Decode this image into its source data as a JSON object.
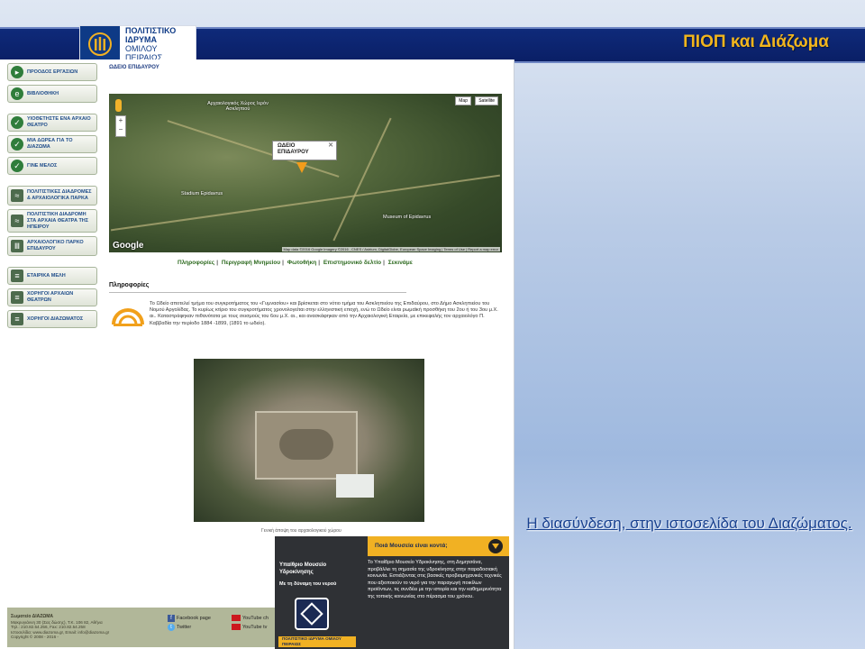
{
  "slide": {
    "title": "ΠΙΟΠ και Διάζωμα",
    "caption": "Η διασύνδεση, στην ιστοσελίδα του Διαζώματος."
  },
  "logo": {
    "line1": "ΠΟΛΙΤΙΣΤΙΚΟ",
    "line2": "ΙΔΡΥΜΑ",
    "line3": "ΟΜΙΛΟΥ",
    "line4": "ΠΕΙΡΑΙΩΣ"
  },
  "nav": [
    {
      "label": "ΠΡΟΟΔΟΣ ΕΡΓΑΣΙΩΝ"
    },
    {
      "label": "ΒΙΒΛΙΟΘΗΚΗ"
    },
    {
      "label": "ΥΙΟΘΕΤΗΣΤΕ ΕΝΑ ΑΡΧΑΙΟ ΘΕΑΤΡΟ"
    },
    {
      "label": "ΜΙΑ ΔΩΡΕΑ ΓΙΑ ΤΟ ΔΙΑΖΩΜΑ"
    },
    {
      "label": "ΓΙΝΕ ΜΕΛΟΣ"
    },
    {
      "label": "ΠΟΛΙΤΙΣΤΙΚΕΣ ΔΙΑΔΡΟΜΕΣ & ΑΡΧΑΙΟΛΟΓΙΚΑ ΠΑΡΚΑ"
    },
    {
      "label": "ΠΟΛΙΤΙΣΤΙΚΗ ΔΙΑΔΡΟΜΗ ΣΤΑ ΑΡΧΑΙΑ ΘΕΑΤΡΑ ΤΗΣ ΗΠΕΙΡΟΥ"
    },
    {
      "label": "ΑΡΧΑΙΟΛΟΓΙΚΟ ΠΑΡΚΟ ΕΠΙΔΑΥΡΟΥ"
    },
    {
      "label": "ΕΤΑΙΡΙΚΑ ΜΕΛΗ"
    },
    {
      "label": "ΧΟΡΗΓΟΙ ΑΡΧΑΙΩΝ ΘΕΑΤΡΩΝ"
    },
    {
      "label": "ΧΟΡΗΓΟΙ ΔΙΑΖΩΜΑΤΟΣ"
    }
  ],
  "page": {
    "crumb": "ΩΔΕΙΟ ΕΠΙΔΑΥΡΟΥ",
    "tabs": [
      "Πληροφορίες",
      "Περιγραφή Μνημείου",
      "Φωτοθήκη",
      "Επιστημονικό δελτίο",
      "Σεκινάμε"
    ],
    "info_heading": "Πληροφορίες",
    "info_text": "Το Ωδείο αποτελεί τμήμα του συγκροτήματος του «Γυμνασίου» και βρίσκεται στο νότιο τμήμα του Ασκληπιείου της Επιδαύρου, στο Δήμο Ασκληπιείου του Νομού Αργολίδας. Το κυρίως κτίριο του συγκροτήματος χρονολογείται στην ελληνιστική εποχή, ενώ το Ωδείο είναι ρωμαϊκή προσθήκη του 2ου ή του 3ου μ.Χ. αι.. Καταστράφηκαν πιθανότατα με τους σεισμούς του 6ου μ.Χ. αι., και ανασκάφηκαν από την Αρχαιολογική Εταιρεία, με επικεφαλής τον αρχαιολόγο Π. Καββαδία την περίοδο 1884 -1899, (1891 το ωδείο).",
    "photo_caption": "Γενική άποψη του αρχαιολογικού χώρου"
  },
  "map": {
    "btn_map": "Map",
    "btn_satellite": "Satellite",
    "popup_line1": "ΩΔΕΙΟ",
    "popup_line2": "ΕΠΙΔΑΥΡΟΥ",
    "label_asklepios": "Αρχαιολογικός Χώρος Ιερόν Ασκληπιού",
    "label_stadium": "Stadium Epidavrus",
    "label_museum": "Museum of Epidavrus",
    "google": "Google",
    "attribution": "Map data ©2016 Google Imagery ©2016 , CNES / Astrium, DigitalGlobe, European Space Imaging | Terms of Use | Report a map error"
  },
  "museum": {
    "header": "Ποιά Μουσεία είναι κοντά;",
    "name": "Υπαίθριο Μουσείο Υδροκίνησης",
    "subtitle": "Με τη δύναμη του νερού",
    "footer": "ΠΟΛΙΤΙΣΤΙΚΟ ΙΔΡΥΜΑ ΟΜΙΛΟΥ ΠΕΙΡΑΙΩΣ",
    "description": "Το Υπαίθριο Μουσείο Υδροκίνησης, στη Δημητσάνα, προβάλλει τη σημασία της υδροκίνησης στην παραδοσιακή κοινωνία. Εστιάζοντας στις βασικές προβιομηχανικές τεχνικές που αξιοποιούν το νερό για την παραγωγή ποικίλων προϊόντων, τις συνδέει με την ιστορία και την καθημερινότητα της τοπικής κοινωνίας στο πέρασμα του χρόνου."
  },
  "footer": {
    "org": "Σωματείο ΔΙΑΖΩΜΑ",
    "addr": "Μακρυγιάννη 30 (Σας δώσης), Τ.Κ. 106 82, Αθήνα",
    "tel": "Τηλ.: 210.82.54.256, Fax: 210.82.54.258",
    "web": "Ιστοσελίδα: www.diazoma.gr, Email: info@diazoma.gr",
    "copy": "Copyright © 2008 - 2016 -",
    "facebook": "Facebook page",
    "twitter": "Twitter",
    "yt1": "YouTube ch",
    "yt2": "YouTube tv"
  }
}
